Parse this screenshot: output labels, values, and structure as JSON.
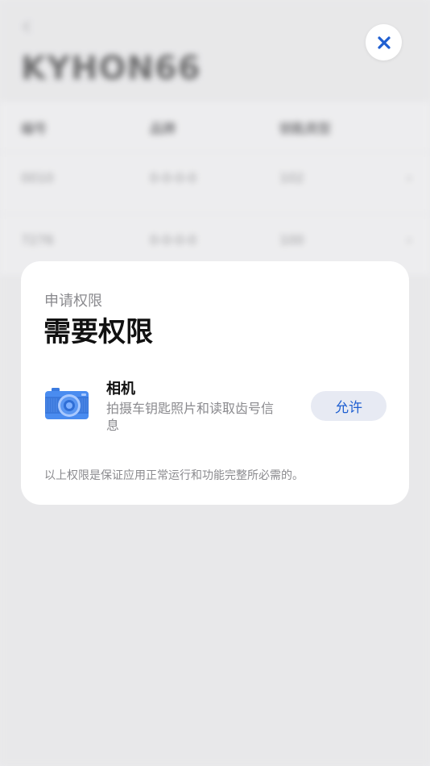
{
  "background": {
    "back_label": "‹",
    "title": "KYHON66",
    "table": {
      "headers": [
        "编号",
        "品牌",
        "钥匙类型",
        ""
      ],
      "rows": [
        [
          "0010",
          "0-0-0-0",
          "102",
          "›"
        ],
        [
          "7276",
          "0-0-0-0",
          "100",
          "›"
        ]
      ]
    }
  },
  "dialog": {
    "subtitle": "申请权限",
    "title": "需要权限",
    "permission": {
      "name": "相机",
      "description": "拍摄车钥匙照片和读取齿号信息",
      "icon": "camera-icon",
      "allow_label": "允许"
    },
    "footer": "以上权限是保证应用正常运行和功能完整所必需的。"
  },
  "close_button": {
    "icon": "close-icon"
  },
  "colors": {
    "accent": "#1f5fd1",
    "allow_bg": "#e7eaf3",
    "dialog_bg": "#ffffff",
    "page_bg": "#ececed"
  }
}
